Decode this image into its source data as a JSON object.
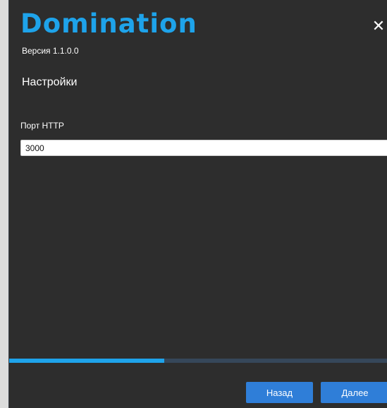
{
  "header": {
    "logo_text": "Domination",
    "version": "Версия 1.1.0.0",
    "close_glyph": "✕"
  },
  "settings": {
    "title": "Настройки",
    "http_port": {
      "label": "Порт HTTP",
      "value": "3000"
    }
  },
  "progress": {
    "fraction": 0.41
  },
  "footer": {
    "back_label": "Назад",
    "next_label": "Далее"
  },
  "colors": {
    "accent": "#1ea3ea",
    "button": "#2f7ed8",
    "background": "#2d2d2d"
  },
  "icons": {
    "close": "close-icon"
  }
}
